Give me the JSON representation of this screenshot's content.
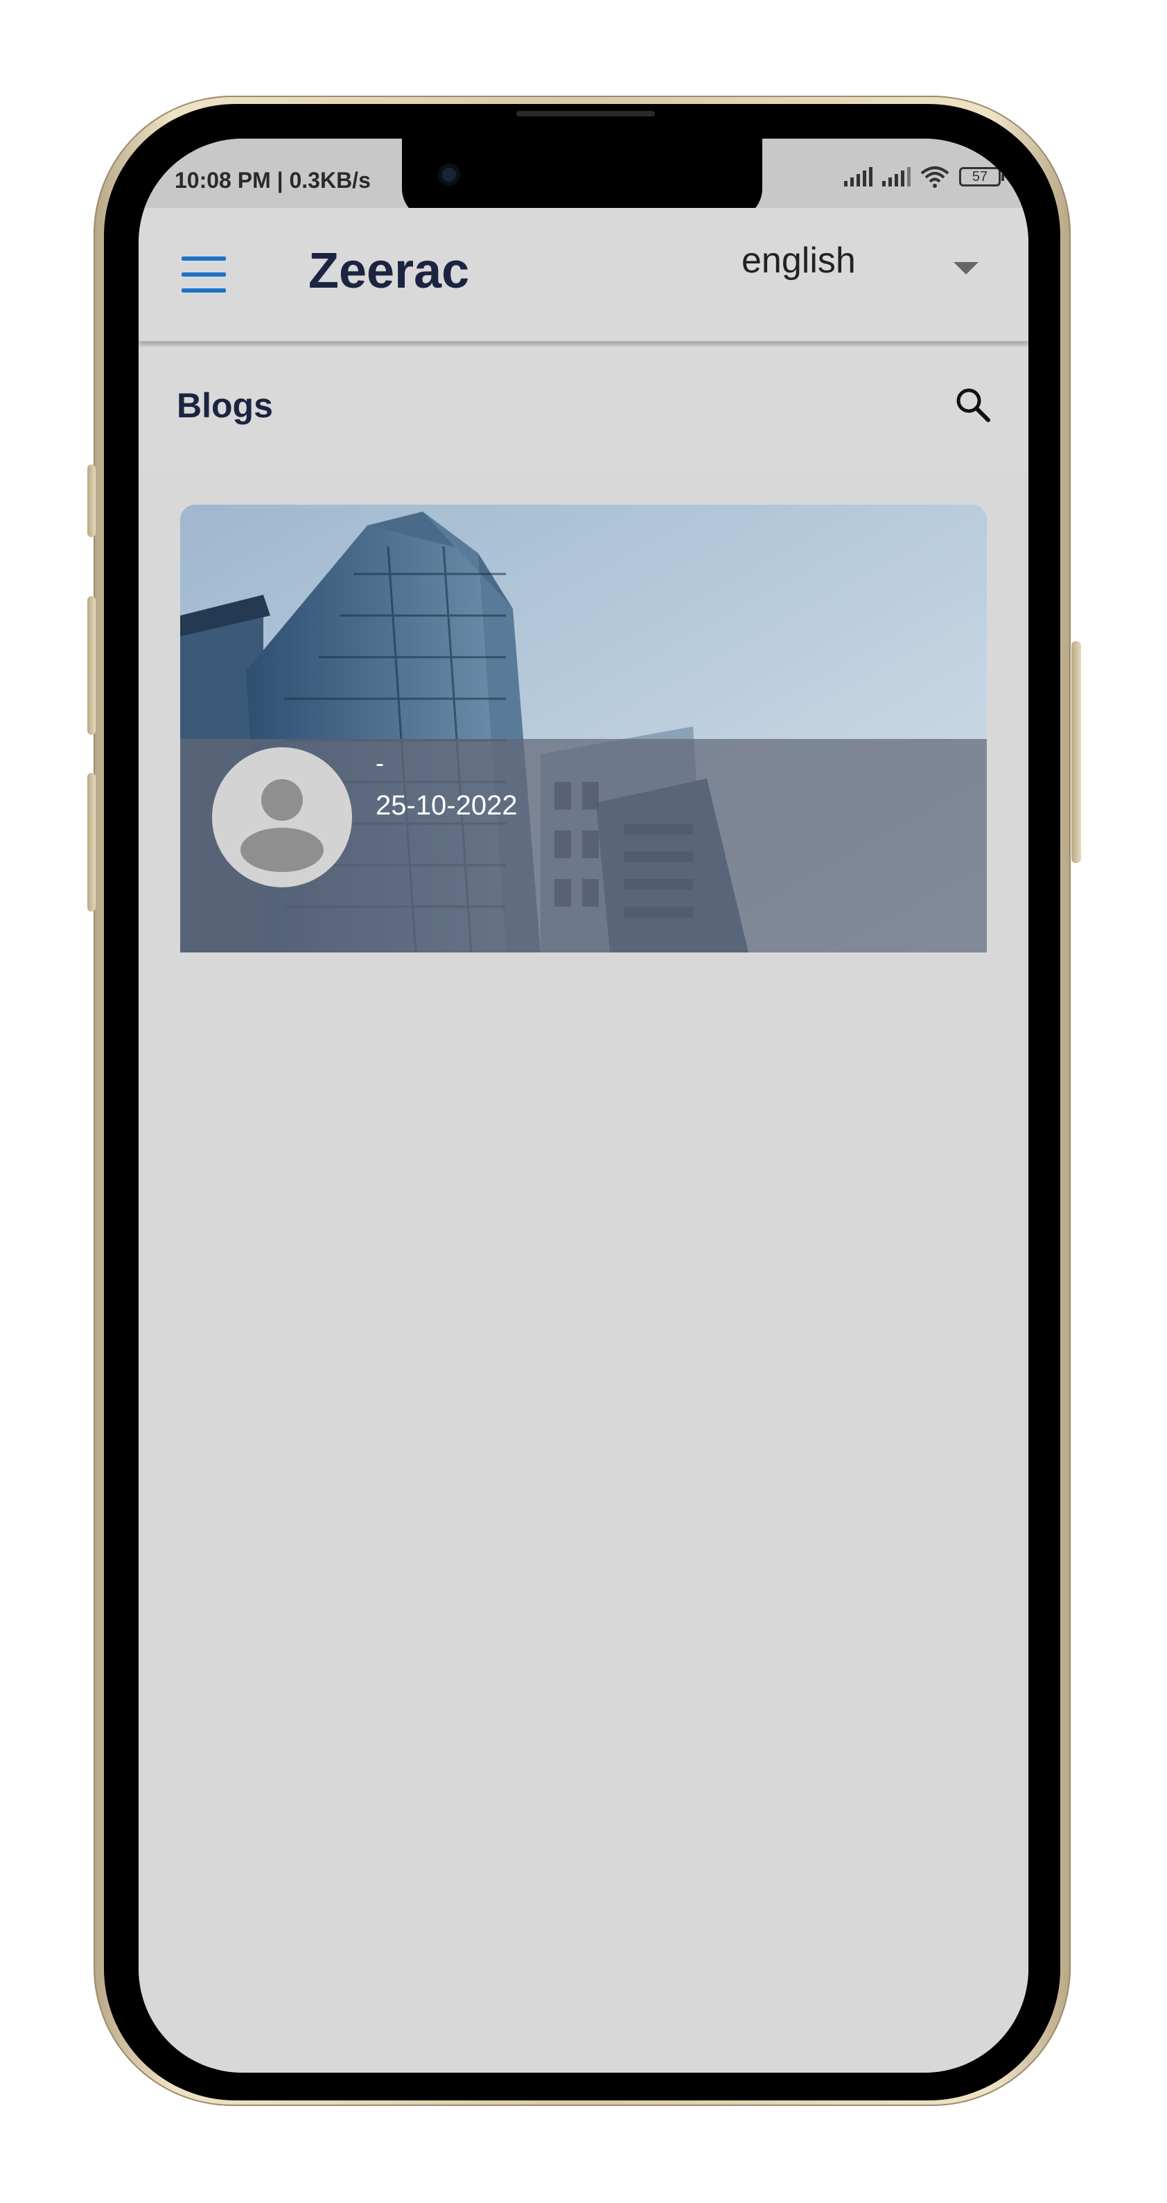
{
  "status_bar": {
    "time_text": "10:08 PM | 0.3KB/s",
    "battery_level": "57",
    "icons": [
      "signal-icon",
      "signal-icon",
      "wifi-icon",
      "battery-icon"
    ]
  },
  "app_bar": {
    "menu_icon": "hamburger-menu-icon",
    "title": "Zeerac",
    "language_selected": "english",
    "language_icon": "dropdown-arrow-icon",
    "accent_color": "#1e72c8"
  },
  "section": {
    "title": "Blogs",
    "search_icon": "search-icon"
  },
  "blogs": [
    {
      "image_icon": "building-image",
      "avatar_icon": "user-avatar-icon",
      "author": "-",
      "date": "25-10-2022"
    }
  ],
  "colors": {
    "background": "#d8d8d8",
    "title": "#1b2440",
    "status_bar": "#c8c8c8"
  }
}
